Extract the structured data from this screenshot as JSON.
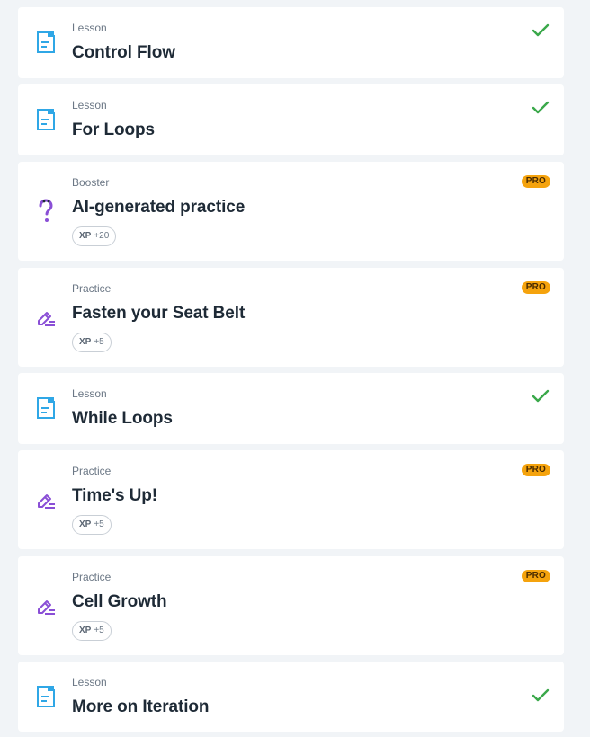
{
  "colors": {
    "lesson_icon": "#2fa7e6",
    "practice_icon": "#8a4fd6",
    "check": "#3aa84a",
    "pro_badge": "#f5a30d",
    "background": "#f1f4f7"
  },
  "items": [
    {
      "kind": "Lesson",
      "title": "Control Flow",
      "icon": "document-icon",
      "status": "completed"
    },
    {
      "kind": "Lesson",
      "title": "For Loops",
      "icon": "document-icon",
      "status": "completed"
    },
    {
      "kind": "Booster",
      "title": "AI-generated practice",
      "icon": "question-mark-icon",
      "pro": "PRO",
      "xp_label": "XP",
      "xp_value": "+20"
    },
    {
      "kind": "Practice",
      "title": "Fasten your Seat Belt",
      "icon": "pencil-icon",
      "pro": "PRO",
      "xp_label": "XP",
      "xp_value": "+5"
    },
    {
      "kind": "Lesson",
      "title": "While Loops",
      "icon": "document-icon",
      "status": "completed"
    },
    {
      "kind": "Practice",
      "title": "Time's Up!",
      "icon": "pencil-icon",
      "pro": "PRO",
      "xp_label": "XP",
      "xp_value": "+5"
    },
    {
      "kind": "Practice",
      "title": "Cell Growth",
      "icon": "pencil-icon",
      "pro": "PRO",
      "xp_label": "XP",
      "xp_value": "+5"
    },
    {
      "kind": "Lesson",
      "title": "More on Iteration",
      "icon": "document-icon",
      "status": "completed"
    }
  ]
}
